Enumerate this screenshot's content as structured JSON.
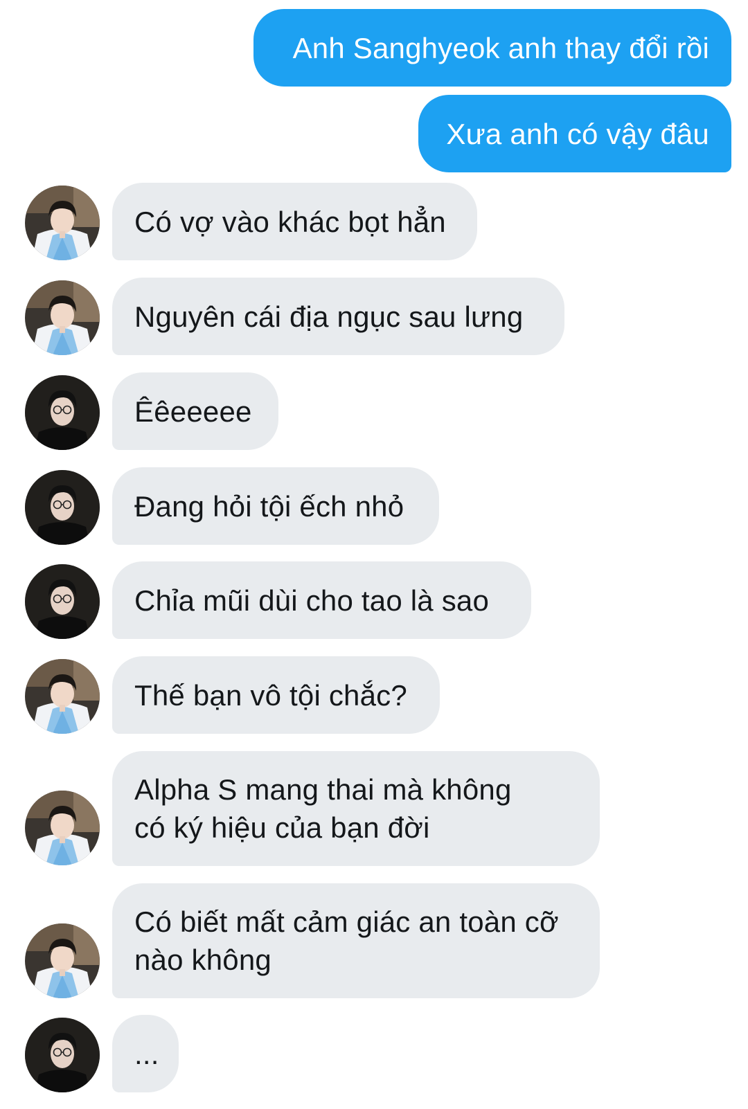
{
  "conversation": {
    "outgoing": [
      {
        "text": "Anh Sanghyeok anh thay đổi rồi"
      },
      {
        "text": "Xưa anh có vậy đâu"
      }
    ],
    "incoming": [
      {
        "sender_avatar": "hanbok-avatar",
        "text": "Có vợ vào khác bọt hẳn"
      },
      {
        "sender_avatar": "hanbok-avatar",
        "text": "Nguyên cái địa ngục sau lưng"
      },
      {
        "sender_avatar": "dark-glasses-avatar",
        "text": "Êêeeeee"
      },
      {
        "sender_avatar": "dark-glasses-avatar",
        "text": "Đang hỏi tội ếch nhỏ"
      },
      {
        "sender_avatar": "dark-glasses-avatar",
        "text": "Chỉa mũi dùi cho tao là sao"
      },
      {
        "sender_avatar": "hanbok-avatar",
        "text": "Thế bạn vô tội chắc?"
      },
      {
        "sender_avatar": "hanbok-avatar",
        "text": "Alpha S mang thai mà không có ký hiệu của bạn đời"
      },
      {
        "sender_avatar": "hanbok-avatar",
        "text": "Có biết mất cảm giác an toàn cỡ nào không"
      },
      {
        "sender_avatar": "dark-glasses-avatar",
        "text": "..."
      }
    ]
  },
  "colors": {
    "outgoing_bubble": "#1da1f2",
    "incoming_bubble": "#e8ebee",
    "outgoing_text": "#ffffff",
    "incoming_text": "#14171a"
  }
}
